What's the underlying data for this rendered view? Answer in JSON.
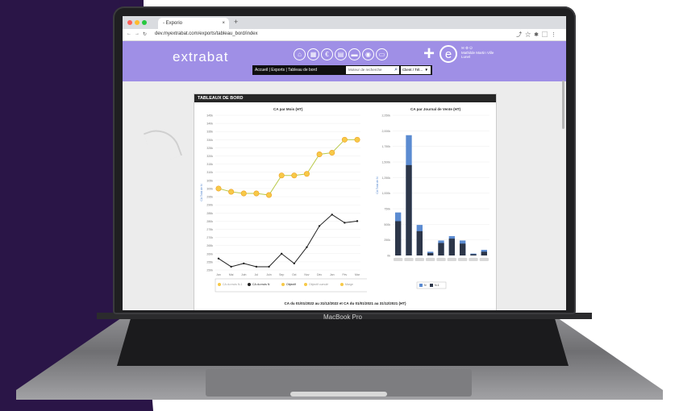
{
  "browser": {
    "tab_title": "- Exporio",
    "url": "dev.myextrabat.com/exports/tableau_bord/index",
    "close_glyph": "×",
    "new_tab_glyph": "+"
  },
  "app": {
    "logo": "extrabat",
    "plus": "+",
    "e_mark": "e",
    "user_text": "Mathilde Martin Ville  Lunel",
    "nav_icons": [
      "home-icon",
      "calendar-icon",
      "euro-icon",
      "catalog-icon",
      "truck-icon",
      "location-icon",
      "document-icon"
    ],
    "breadcrumb": "Accueil | Exports | Tableau de bord",
    "search_placeholder": "Moteur de recherche",
    "client_select": "Client / Tél..."
  },
  "dashboard": {
    "title": "TABLEAUX DE BORD",
    "footer": "CA du 01/01/2022 au 31/12/2022 et CA du 01/01/2021 au 31/12/2021 (HT)"
  },
  "laptop": {
    "label": "MacBook Pro"
  },
  "chart_data": [
    {
      "type": "line",
      "title": "CA par Mois (HT)",
      "ylabel": "CA Total de N",
      "categories": [
        "Jan",
        "Mai",
        "Juin",
        "Jul",
        "Juin",
        "Sep",
        "Oct",
        "Nov",
        "Déc",
        "Jan",
        "Fév",
        "Mar"
      ],
      "y_ticks": [
        "250k",
        "255k",
        "260k",
        "265k",
        "270k",
        "275k",
        "280k",
        "285k",
        "290k",
        "295k",
        "300k",
        "305k",
        "310k",
        "315k",
        "320k",
        "325k",
        "330k",
        "335k",
        "340k",
        "345k"
      ],
      "ylim": [
        250,
        345
      ],
      "series": [
        {
          "name": "Objectif",
          "color": "#b9c94a",
          "values": [
            300,
            298,
            297,
            297,
            296,
            308,
            308,
            309,
            321,
            322,
            330,
            330
          ]
        },
        {
          "name": "CA du mois N",
          "color": "#222222",
          "values": [
            257,
            252,
            254,
            252,
            252,
            260,
            254,
            264,
            277,
            284,
            279,
            280
          ]
        }
      ],
      "legend": [
        "CA du mois N-1",
        "CA du mois N",
        "Objectif",
        "Objectif cumulé",
        "Marge"
      ],
      "grid": true
    },
    {
      "type": "bar",
      "title": "CA par Journal de Vente (HT)",
      "ylabel": "CA Total de N",
      "y_ticks": [
        "0k",
        "250k",
        "500k",
        "750k",
        "1,000k",
        "1,250k",
        "1,500k",
        "1,750k",
        "2,000k",
        "2,250k"
      ],
      "ylim": [
        0,
        2250
      ],
      "series": [
        {
          "name": "N",
          "color": "#5b8bd1",
          "values": [
            690,
            1930,
            490,
            60,
            240,
            310,
            240,
            30,
            90
          ]
        },
        {
          "name": "N-1",
          "color": "#2c3649",
          "values": [
            550,
            1450,
            390,
            40,
            200,
            270,
            190,
            20,
            60
          ]
        }
      ],
      "grid": true
    }
  ]
}
